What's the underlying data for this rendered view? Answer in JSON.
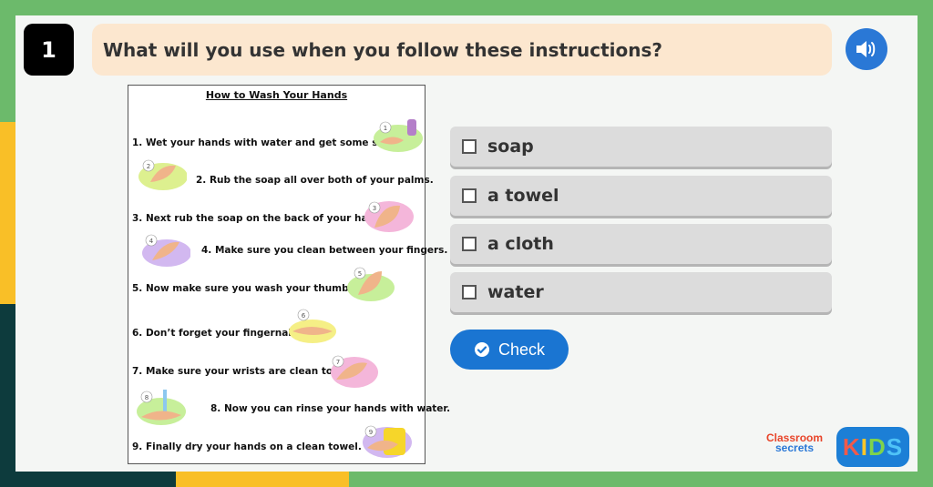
{
  "question": {
    "number": "1",
    "text": "What will you use when you follow these instructions?"
  },
  "icons": {
    "speaker": "speaker-icon",
    "check": "check-circle-icon"
  },
  "document": {
    "title": "How to Wash Your Hands",
    "steps": [
      "1. Wet your hands with water and get some soap.",
      "2. Rub the soap all over both of your palms.",
      "3. Next rub the soap on the back of your hands",
      "4. Make sure you clean between your fingers.",
      "5. Now make sure you wash your thumbs.",
      "6. Don’t forget your fingernails.",
      "7. Make sure your wrists are clean too.",
      "8. Now you can rinse your hands with water.",
      "9. Finally dry your hands on a clean towel."
    ],
    "image_numbers": [
      "1",
      "2",
      "3",
      "4",
      "5",
      "6",
      "7",
      "8",
      "9"
    ]
  },
  "options": [
    {
      "label": "soap",
      "checked": false
    },
    {
      "label": "a towel",
      "checked": false
    },
    {
      "label": "a cloth",
      "checked": false
    },
    {
      "label": "water",
      "checked": false
    }
  ],
  "check_button": {
    "label": "Check"
  },
  "branding": {
    "classroom_line1": "Classroom",
    "classroom_line2": "secrets",
    "kids": [
      "K",
      "I",
      "D",
      "S"
    ]
  },
  "colors": {
    "background_green": "#6cba6b",
    "question_bg": "#fce7cf",
    "accent_blue": "#1a75d2",
    "option_bg": "#dcdcdc"
  }
}
